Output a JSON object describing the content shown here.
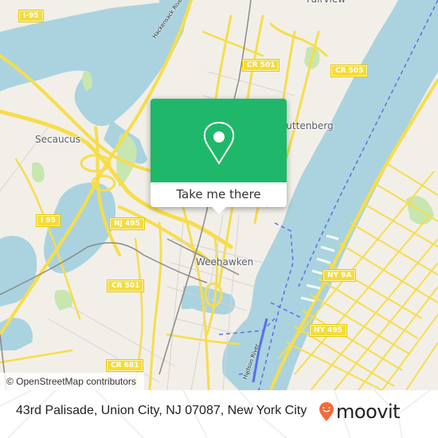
{
  "map": {
    "colors": {
      "land": "#f2efe9",
      "water": "#aad3df",
      "park": "#c8e6b0",
      "road_major": "#f7dd4a",
      "road_minor": "#d9d4cc",
      "rail": "#8a8a8a",
      "ferry": "#5b6ee6"
    },
    "places": [
      {
        "name": "Secaucus"
      },
      {
        "name": "Weehawken"
      },
      {
        "name": "Guttenberg"
      },
      {
        "name": "Fairview"
      }
    ],
    "shields": [
      {
        "label": "I-95"
      },
      {
        "label": "I 95"
      },
      {
        "label": "NJ 495"
      },
      {
        "label": "CR 501"
      },
      {
        "label": "CR 501"
      },
      {
        "label": "CR 505"
      },
      {
        "label": "NY 9A"
      },
      {
        "label": "NY 495"
      },
      {
        "label": "CR 681"
      }
    ],
    "water_labels": [
      {
        "name": "Hackensack River"
      },
      {
        "name": "Hudson River"
      }
    ],
    "attribution": "© OpenStreetMap contributors"
  },
  "popup": {
    "icon": "map-pin-icon",
    "button_label": "Take me there",
    "color": "#1fb86a"
  },
  "footer": {
    "address": "43rd Palisade, Union City, NJ 07087, New York City",
    "brand": "moovit",
    "brand_color": "#f26b3a"
  }
}
